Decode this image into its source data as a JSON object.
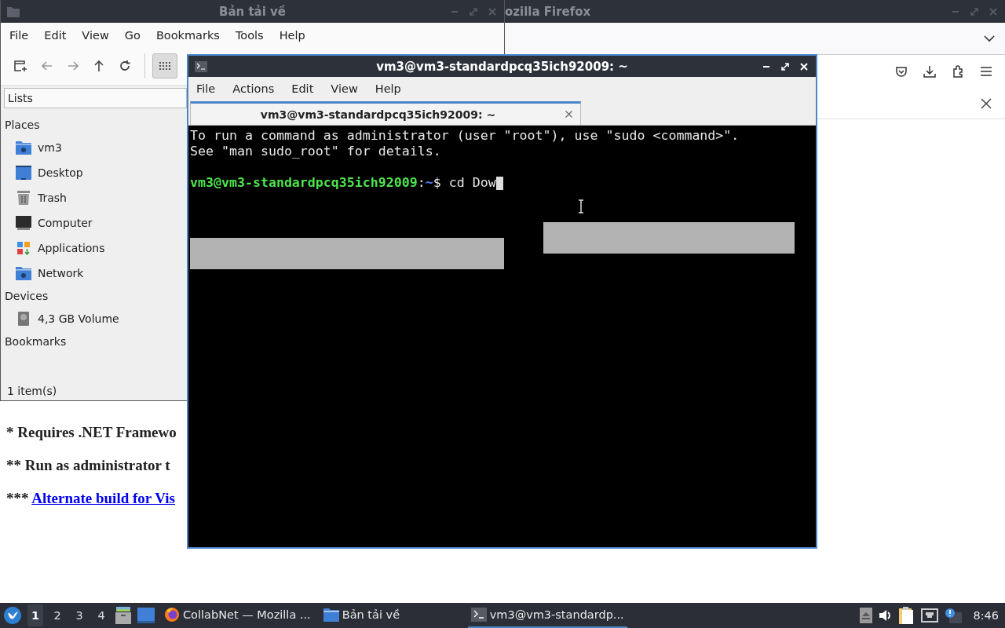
{
  "browser_window": {
    "title": "ozilla Firefox",
    "page_lines": [
      {
        "prefix": "* ",
        "text": "Requires .NET Framewo",
        "kind": "text"
      },
      {
        "prefix": "** ",
        "text": "Run as administrator t",
        "kind": "text"
      },
      {
        "prefix": "*** ",
        "text": "Alternate build for Vis",
        "kind": "link"
      }
    ]
  },
  "file_manager": {
    "title": "Bản tải về",
    "menu": [
      "File",
      "Edit",
      "View",
      "Go",
      "Bookmarks",
      "Tools",
      "Help"
    ],
    "side_panel_mode": "Lists",
    "sections": [
      {
        "title": "Places",
        "items": [
          {
            "label": "vm3",
            "kind": "home"
          },
          {
            "label": "Desktop",
            "kind": "desktop"
          },
          {
            "label": "Trash",
            "kind": "trash"
          },
          {
            "label": "Computer",
            "kind": "computer"
          },
          {
            "label": "Applications",
            "kind": "applications"
          },
          {
            "label": "Network",
            "kind": "network"
          }
        ]
      },
      {
        "title": "Devices",
        "items": [
          {
            "label": "4,3 GB Volume",
            "kind": "drive"
          }
        ]
      },
      {
        "title": "Bookmarks"
      }
    ],
    "status": "1 item(s)"
  },
  "terminal": {
    "title": "vm3@vm3-standardpcq35ich92009: ~",
    "menu": [
      "File",
      "Actions",
      "Edit",
      "View",
      "Help"
    ],
    "tabs": [
      {
        "label": "vm3@vm3-standardpcq35ich92009: ~",
        "selected": true
      }
    ],
    "lines": [
      {
        "kind": "output",
        "text": "To run a command as administrator (user \"root\"), use \"sudo <command>\"."
      },
      {
        "kind": "output",
        "text": "See \"man sudo_root\" for details."
      },
      {
        "kind": "blank"
      },
      {
        "kind": "prompt",
        "user_host": "vm3@vm3-standardpcq35ich92009",
        "separator": ":",
        "path": "~",
        "symbol": "$",
        "command": "cd Dow",
        "cursor": true
      }
    ]
  },
  "taskbar": {
    "workspaces": [
      {
        "label": "1",
        "selected": true
      },
      {
        "label": "2",
        "selected": false
      },
      {
        "label": "3",
        "selected": false
      },
      {
        "label": "4",
        "selected": false
      }
    ],
    "tasks": [
      {
        "label": "CollabNet — Mozilla ...",
        "kind": "browser",
        "selected": false
      },
      {
        "label": "Bản tải về",
        "kind": "folder",
        "selected": false
      },
      {
        "label": "vm3@vm3-standardp...",
        "kind": "terminal",
        "selected": true
      }
    ],
    "clock": "8:46"
  }
}
